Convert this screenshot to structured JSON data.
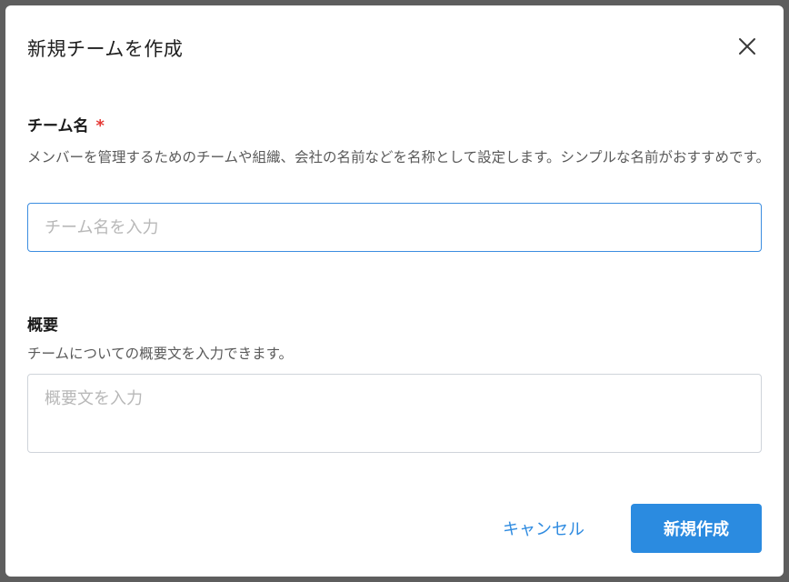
{
  "dialog": {
    "title": "新規チームを作成",
    "close_icon": "close-icon"
  },
  "team_name": {
    "label": "チーム名",
    "required_mark": "*",
    "help": "メンバーを管理するためのチームや組織、会社の名前などを名称として設定します。シンプルな名前がおすすめです。",
    "value": "",
    "placeholder": "チーム名を入力"
  },
  "summary": {
    "label": "概要",
    "help": "チームについての概要文を入力できます。",
    "value": "",
    "placeholder": "概要文を入力"
  },
  "actions": {
    "cancel_label": "キャンセル",
    "create_label": "新規作成"
  },
  "colors": {
    "accent": "#2b8be0",
    "required": "#e53935",
    "overlay": "#5e5e5e"
  }
}
